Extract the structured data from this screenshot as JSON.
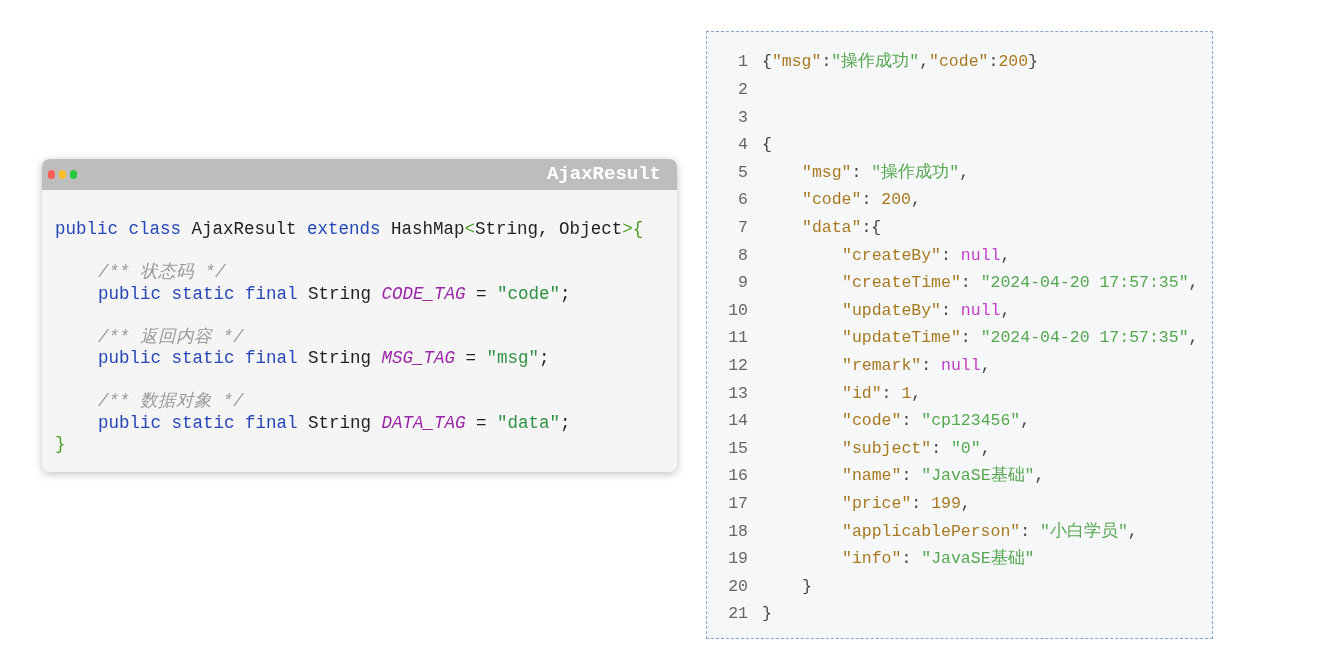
{
  "code_window": {
    "title": "AjaxResult",
    "dots": [
      {
        "color": "#ff5f56"
      },
      {
        "color": "#ffbd2e"
      },
      {
        "color": "#27c93f"
      }
    ],
    "lines": [
      {
        "kind": "top",
        "tokens": [
          {
            "kind": "keyword",
            "text": "public class"
          },
          {
            "kind": "plain",
            "text": " AjaxResult "
          },
          {
            "kind": "keyword",
            "text": "extends"
          },
          {
            "kind": "plain",
            "text": " HashMap"
          },
          {
            "kind": "brace",
            "text": "<"
          },
          {
            "kind": "plain",
            "text": "String, Object"
          },
          {
            "kind": "brace",
            "text": ">{"
          }
        ]
      },
      {
        "kind": "blank"
      },
      {
        "kind": "body",
        "tokens": [
          {
            "kind": "comment",
            "text": "/** 状态码 */"
          }
        ]
      },
      {
        "kind": "body",
        "tokens": [
          {
            "kind": "keyword",
            "text": "public static final"
          },
          {
            "kind": "plain",
            "text": " String "
          },
          {
            "kind": "constant",
            "text": "CODE_TAG"
          },
          {
            "kind": "plain",
            "text": " = "
          },
          {
            "kind": "string",
            "text": "\"code\""
          },
          {
            "kind": "plain",
            "text": ";"
          }
        ]
      },
      {
        "kind": "blank"
      },
      {
        "kind": "body",
        "tokens": [
          {
            "kind": "comment",
            "text": "/** 返回内容 */"
          }
        ]
      },
      {
        "kind": "body",
        "tokens": [
          {
            "kind": "keyword",
            "text": "public static final"
          },
          {
            "kind": "plain",
            "text": " String "
          },
          {
            "kind": "constant",
            "text": "MSG_TAG"
          },
          {
            "kind": "plain",
            "text": " = "
          },
          {
            "kind": "string",
            "text": "\"msg\""
          },
          {
            "kind": "plain",
            "text": ";"
          }
        ]
      },
      {
        "kind": "blank"
      },
      {
        "kind": "body",
        "tokens": [
          {
            "kind": "comment",
            "text": "/** 数据对象 */"
          }
        ]
      },
      {
        "kind": "body",
        "tokens": [
          {
            "kind": "keyword",
            "text": "public static final"
          },
          {
            "kind": "plain",
            "text": " String "
          },
          {
            "kind": "constant",
            "text": "DATA_TAG"
          },
          {
            "kind": "plain",
            "text": " = "
          },
          {
            "kind": "string",
            "text": "\"data\""
          },
          {
            "kind": "plain",
            "text": ";"
          }
        ]
      },
      {
        "kind": "top",
        "tokens": [
          {
            "kind": "brace",
            "text": "}"
          }
        ]
      }
    ]
  },
  "json_listing": {
    "lines": [
      {
        "number": "1",
        "kind": "top",
        "tokens": [
          {
            "kind": "punct",
            "text": "{"
          },
          {
            "kind": "key",
            "text": "\"msg\""
          },
          {
            "kind": "punct",
            "text": ":"
          },
          {
            "kind": "string",
            "text": "\"操作成功\""
          },
          {
            "kind": "punct",
            "text": ","
          },
          {
            "kind": "key",
            "text": "\"code\""
          },
          {
            "kind": "punct",
            "text": ":"
          },
          {
            "kind": "number",
            "text": "200"
          },
          {
            "kind": "punct",
            "text": "}"
          }
        ]
      },
      {
        "number": "2"
      },
      {
        "number": "3"
      },
      {
        "number": "4",
        "kind": "top",
        "tokens": [
          {
            "kind": "punct",
            "text": "{"
          }
        ]
      },
      {
        "number": "5",
        "kind": "member",
        "tokens": [
          {
            "kind": "key",
            "text": "\"msg\""
          },
          {
            "kind": "punct",
            "text": ": "
          },
          {
            "kind": "string",
            "text": "\"操作成功\""
          },
          {
            "kind": "punct",
            "text": ","
          }
        ]
      },
      {
        "number": "6",
        "kind": "member",
        "tokens": [
          {
            "kind": "key",
            "text": "\"code\""
          },
          {
            "kind": "punct",
            "text": ": "
          },
          {
            "kind": "number",
            "text": "200"
          },
          {
            "kind": "punct",
            "text": ","
          }
        ]
      },
      {
        "number": "7",
        "kind": "member",
        "tokens": [
          {
            "kind": "key",
            "text": "\"data\""
          },
          {
            "kind": "punct",
            "text": ":{"
          }
        ]
      },
      {
        "number": "8",
        "kind": "field",
        "tokens": [
          {
            "kind": "key",
            "text": "\"createBy\""
          },
          {
            "kind": "punct",
            "text": ": "
          },
          {
            "kind": "null",
            "text": "null"
          },
          {
            "kind": "punct",
            "text": ","
          }
        ]
      },
      {
        "number": "9",
        "kind": "field",
        "tokens": [
          {
            "kind": "key",
            "text": "\"createTime\""
          },
          {
            "kind": "punct",
            "text": ": "
          },
          {
            "kind": "string",
            "text": "\"2024-04-20 17:57:35\""
          },
          {
            "kind": "punct",
            "text": ","
          }
        ]
      },
      {
        "number": "10",
        "kind": "field",
        "tokens": [
          {
            "kind": "key",
            "text": "\"updateBy\""
          },
          {
            "kind": "punct",
            "text": ": "
          },
          {
            "kind": "null",
            "text": "null"
          },
          {
            "kind": "punct",
            "text": ","
          }
        ]
      },
      {
        "number": "11",
        "kind": "field",
        "tokens": [
          {
            "kind": "key",
            "text": "\"updateTime\""
          },
          {
            "kind": "punct",
            "text": ": "
          },
          {
            "kind": "string",
            "text": "\"2024-04-20 17:57:35\""
          },
          {
            "kind": "punct",
            "text": ","
          }
        ]
      },
      {
        "number": "12",
        "kind": "field",
        "tokens": [
          {
            "kind": "key",
            "text": "\"remark\""
          },
          {
            "kind": "punct",
            "text": ": "
          },
          {
            "kind": "null",
            "text": "null"
          },
          {
            "kind": "punct",
            "text": ","
          }
        ]
      },
      {
        "number": "13",
        "kind": "field",
        "tokens": [
          {
            "kind": "key",
            "text": "\"id\""
          },
          {
            "kind": "punct",
            "text": ": "
          },
          {
            "kind": "number",
            "text": "1"
          },
          {
            "kind": "punct",
            "text": ","
          }
        ]
      },
      {
        "number": "14",
        "kind": "field",
        "tokens": [
          {
            "kind": "key",
            "text": "\"code\""
          },
          {
            "kind": "punct",
            "text": ": "
          },
          {
            "kind": "string",
            "text": "\"cp123456\""
          },
          {
            "kind": "punct",
            "text": ","
          }
        ]
      },
      {
        "number": "15",
        "kind": "field",
        "tokens": [
          {
            "kind": "key",
            "text": "\"subject\""
          },
          {
            "kind": "punct",
            "text": ": "
          },
          {
            "kind": "string",
            "text": "\"0\""
          },
          {
            "kind": "punct",
            "text": ","
          }
        ]
      },
      {
        "number": "16",
        "kind": "field",
        "tokens": [
          {
            "kind": "key",
            "text": "\"name\""
          },
          {
            "kind": "punct",
            "text": ": "
          },
          {
            "kind": "string",
            "text": "\"JavaSE基础\""
          },
          {
            "kind": "punct",
            "text": ","
          }
        ]
      },
      {
        "number": "17",
        "kind": "field",
        "tokens": [
          {
            "kind": "key",
            "text": "\"price\""
          },
          {
            "kind": "punct",
            "text": ": "
          },
          {
            "kind": "number",
            "text": "199"
          },
          {
            "kind": "punct",
            "text": ","
          }
        ]
      },
      {
        "number": "18",
        "kind": "field",
        "tokens": [
          {
            "kind": "key",
            "text": "\"applicablePerson\""
          },
          {
            "kind": "punct",
            "text": ": "
          },
          {
            "kind": "string",
            "text": "\"小白学员\""
          },
          {
            "kind": "punct",
            "text": ","
          }
        ]
      },
      {
        "number": "19",
        "kind": "field",
        "tokens": [
          {
            "kind": "key",
            "text": "\"info\""
          },
          {
            "kind": "punct",
            "text": ": "
          },
          {
            "kind": "string",
            "text": "\"JavaSE基础\""
          }
        ]
      },
      {
        "number": "20",
        "kind": "member",
        "tokens": [
          {
            "kind": "punct",
            "text": "}"
          }
        ]
      },
      {
        "number": "21",
        "kind": "top",
        "tokens": [
          {
            "kind": "punct",
            "text": "}"
          }
        ]
      }
    ]
  }
}
